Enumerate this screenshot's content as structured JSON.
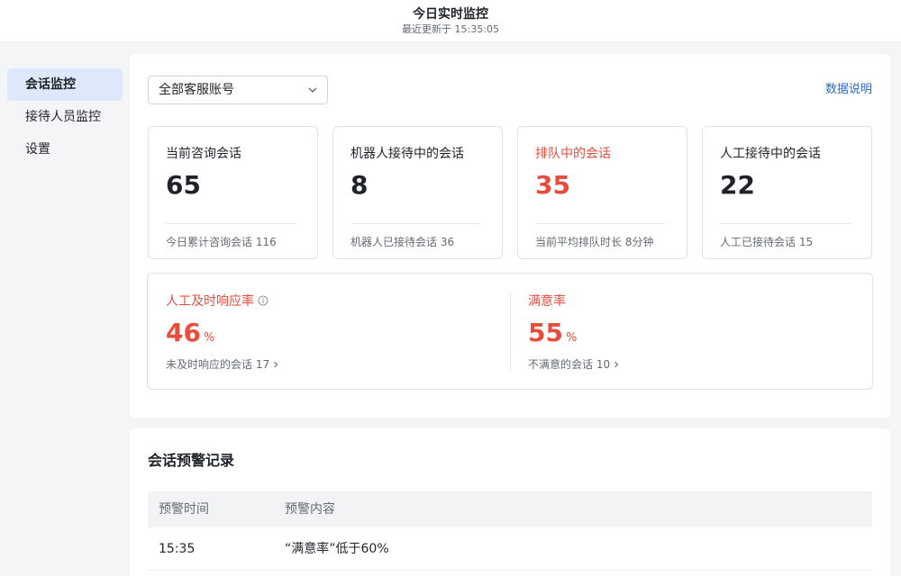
{
  "header": {
    "title": "今日实时监控",
    "updated": "最近更新于 15:35:05"
  },
  "sidebar": {
    "items": [
      {
        "label": "会话监控",
        "active": true
      },
      {
        "label": "接待人员监控",
        "active": false
      },
      {
        "label": "设置",
        "active": false
      }
    ]
  },
  "filter": {
    "account_select": "全部客服账号",
    "doc_link": "数据说明"
  },
  "cards": [
    {
      "label": "当前咨询会话",
      "value": "65",
      "foot": "今日累计咨询会话 116"
    },
    {
      "label": "机器人接待中的会话",
      "value": "8",
      "foot": "机器人已接待会话 36"
    },
    {
      "label": "排队中的会话",
      "value": "35",
      "foot": "当前平均排队时长 8分钟"
    },
    {
      "label": "人工接待中的会话",
      "value": "22",
      "foot": "人工已接待会话 15"
    }
  ],
  "rates": {
    "response": {
      "label": "人工及时响应率",
      "value": "46",
      "unit": "%",
      "link": "未及时响应的会话 17"
    },
    "satisfaction": {
      "label": "满意率",
      "value": "55",
      "unit": "%",
      "link": "不满意的会话 10"
    }
  },
  "alerts": {
    "title": "会话预警记录",
    "columns": [
      "预警时间",
      "预警内容"
    ],
    "rows": [
      {
        "time": "15:35",
        "content": "“满意率”低于60%"
      }
    ]
  },
  "colors": {
    "alert": "#e84c3d",
    "link": "#2c6bc4",
    "active_nav": "#dde9fb"
  }
}
